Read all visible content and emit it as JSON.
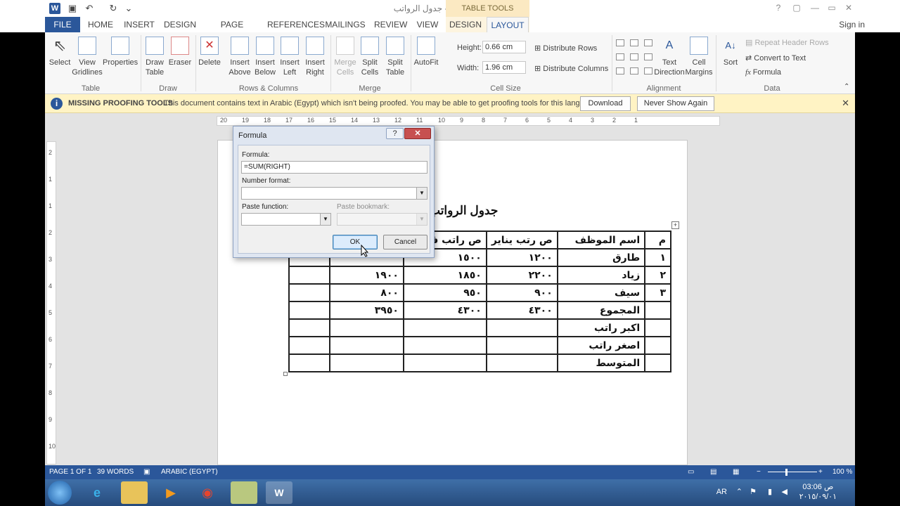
{
  "window": {
    "title": "جدول الرواتب - Microsoft Word",
    "table_tools_label": "TABLE TOOLS",
    "sign_in": "Sign in",
    "help": "?",
    "minimize": "—",
    "maximize": "▭",
    "close": "✕"
  },
  "qat": {
    "word": "W",
    "save": "💾",
    "undo": "↶",
    "redo": "↻",
    "more": "⌄"
  },
  "tabs": [
    "FILE",
    "HOME",
    "INSERT",
    "DESIGN",
    "PAGE LAYOUT",
    "REFERENCES",
    "MAILINGS",
    "REVIEW",
    "VIEW",
    "DESIGN",
    "LAYOUT"
  ],
  "ribbon": {
    "table": {
      "select": "Select",
      "view_gridlines": "View Gridlines",
      "properties": "Properties",
      "group": "Table"
    },
    "draw": {
      "draw_table": "Draw Table",
      "eraser": "Eraser",
      "group": "Draw"
    },
    "rows_cols": {
      "delete": "Delete",
      "insert_above": "Insert Above",
      "insert_below": "Insert Below",
      "insert_left": "Insert Left",
      "insert_right": "Insert Right",
      "group": "Rows & Columns"
    },
    "merge": {
      "merge_cells": "Merge Cells",
      "split_cells": "Split Cells",
      "split_table": "Split Table",
      "group": "Merge"
    },
    "cell_size": {
      "autofit": "AutoFit",
      "height_label": "Height:",
      "height_value": "0.66 cm",
      "width_label": "Width:",
      "width_value": "1.96 cm",
      "distribute_rows": "Distribute Rows",
      "distribute_columns": "Distribute Columns",
      "group": "Cell Size"
    },
    "alignment": {
      "text_direction": "Text Direction",
      "cell_margins": "Cell Margins",
      "group": "Alignment"
    },
    "data": {
      "sort": "Sort",
      "repeat_header_rows": "Repeat Header Rows",
      "convert_to_text": "Convert to Text",
      "formula": "Formula",
      "group": "Data"
    }
  },
  "infobar": {
    "title": "MISSING PROOFING TOOLS",
    "message": "This document contains text in Arabic (Egypt) which isn't being proofed. You may be able to get proofing tools for this language.",
    "download": "Download",
    "never_show": "Never Show Again"
  },
  "ruler_h": [
    "20",
    "19",
    "18",
    "17",
    "16",
    "15",
    "14",
    "13",
    "12",
    "11",
    "10",
    "9",
    "8",
    "7",
    "6",
    "5",
    "4",
    "3",
    "2",
    "1"
  ],
  "ruler_v": [
    "2",
    "1",
    "1",
    "2",
    "3",
    "4",
    "5",
    "6",
    "7",
    "8",
    "9",
    "10"
  ],
  "document": {
    "heading": "جدول الرواتب",
    "table": [
      [
        "م",
        "اسم الموظف",
        "ص رتب يناير",
        "ص راتب فبراير",
        "",
        ""
      ],
      [
        "١",
        "طارق",
        "١٢٠٠",
        "١٥٠٠",
        "",
        ""
      ],
      [
        "٢",
        "زياد",
        "٢٢٠٠",
        "١٨٥٠",
        "١٩٠٠",
        ""
      ],
      [
        "٣",
        "سيف",
        "٩٠٠",
        "٩٥٠",
        "٨٠٠",
        ""
      ],
      [
        "",
        "المجموع",
        "٤٣٠٠",
        "٤٣٠٠",
        "٣٩٥٠",
        ""
      ],
      [
        "",
        "اكبر راتب",
        "",
        "",
        "",
        ""
      ],
      [
        "",
        "اصغر راتب",
        "",
        "",
        "",
        ""
      ],
      [
        "",
        "المتوسط",
        "",
        "",
        "",
        ""
      ]
    ]
  },
  "dialog": {
    "title": "Formula",
    "help": "?",
    "close": "✕",
    "formula_label": "Formula:",
    "formula_value": "=SUM(RIGHT)",
    "number_format_label": "Number format:",
    "paste_function_label": "Paste function:",
    "paste_bookmark_label": "Paste bookmark:",
    "ok": "OK",
    "cancel": "Cancel"
  },
  "status": {
    "page": "PAGE 1 OF 1",
    "words": "39 WORDS",
    "language": "ARABIC (EGYPT)",
    "zoom": "100 %"
  },
  "taskbar": {
    "lang": "AR",
    "time": "03:06 ص",
    "date": "٢٠١٥/٠٩/٠١"
  }
}
